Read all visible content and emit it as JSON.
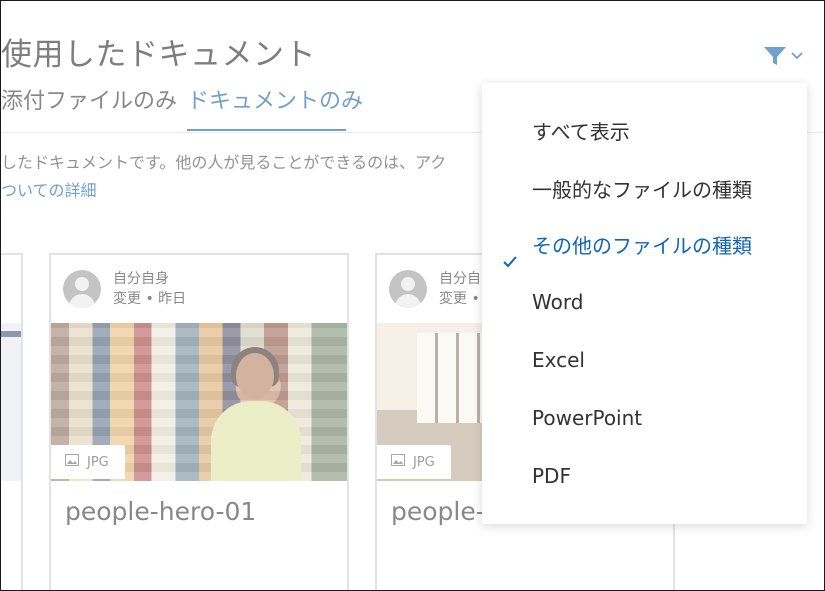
{
  "page": {
    "title": "使用したドキュメント",
    "description": "したドキュメントです。他の人が見ることができるのは、アク",
    "detail_link": "ついての詳細"
  },
  "tabs": [
    {
      "label": "添付ファイルのみ",
      "active": false
    },
    {
      "label": "ドキュメントのみ",
      "active": true
    }
  ],
  "filter": {
    "icon": "filter-icon",
    "chevron": "chevron-down-icon",
    "accent": "#0b5cad"
  },
  "cards": [
    {
      "author": "自分自身",
      "modified": "変更 • 昨日",
      "file_type": "JPG",
      "name": "people-hero-01"
    },
    {
      "author": "自分自",
      "modified": "変更 •",
      "file_type": "JPG",
      "name": "people-"
    }
  ],
  "menu": {
    "items": [
      {
        "label": "すべて表示",
        "selected": false
      },
      {
        "label": "一般的なファイルの種類",
        "selected": false
      },
      {
        "label": "その他のファイルの種類",
        "selected": true
      },
      {
        "label": "Word",
        "selected": false
      },
      {
        "label": "Excel",
        "selected": false
      },
      {
        "label": "PowerPoint",
        "selected": false
      },
      {
        "label": "PDF",
        "selected": false
      }
    ],
    "selected_color": "#1066b4"
  }
}
